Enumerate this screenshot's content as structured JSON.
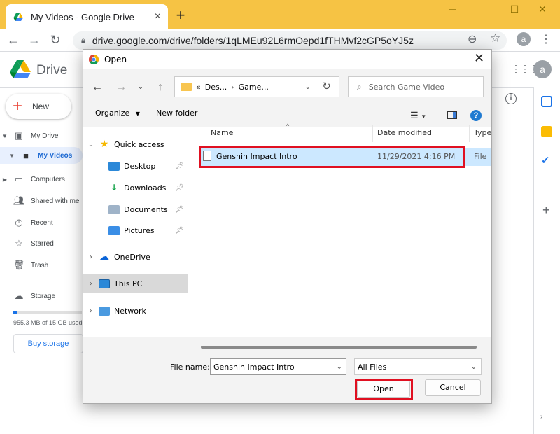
{
  "browser": {
    "tab_title": "My Videos - Google Drive",
    "new_tab": "+",
    "url": "drive.google.com/drive/folders/1qLMEu92L6rmOepd1fTHMvf2cGP5oYJ5z",
    "profile_initial": "a"
  },
  "drive": {
    "brand": "Drive",
    "account_initial": "a",
    "new_label": "New",
    "nav": [
      {
        "label": "My Drive"
      },
      {
        "label": "My Videos"
      },
      {
        "label": "Computers"
      },
      {
        "label": "Shared with me"
      },
      {
        "label": "Recent"
      },
      {
        "label": "Starred"
      },
      {
        "label": "Trash"
      },
      {
        "label": "Storage"
      }
    ],
    "storage_used": 0.06,
    "storage_text": "955.3 MB of 15 GB used",
    "buy_storage": "Buy storage"
  },
  "dialog": {
    "title": "Open",
    "breadcrumb_prefix": "«",
    "breadcrumb": [
      "Des...",
      "Game..."
    ],
    "search_placeholder": "Search Game Video",
    "organize": "Organize",
    "new_folder": "New folder",
    "help": "?",
    "nav_pane": [
      {
        "label": "Quick access"
      },
      {
        "label": "Desktop"
      },
      {
        "label": "Downloads"
      },
      {
        "label": "Documents"
      },
      {
        "label": "Pictures"
      },
      {
        "label": "OneDrive"
      },
      {
        "label": "This PC"
      },
      {
        "label": "Network"
      }
    ],
    "columns": {
      "name": "Name",
      "date": "Date modified",
      "type": "Type"
    },
    "files": [
      {
        "name": "Genshin Impact Intro",
        "date": "11/29/2021 4:16 PM",
        "type": "File"
      }
    ],
    "file_name_label": "File name:",
    "file_name_value": "Genshin Impact Intro",
    "filter": "All Files",
    "open_label": "Open",
    "cancel_label": "Cancel",
    "highlight_color": "#e01021"
  }
}
